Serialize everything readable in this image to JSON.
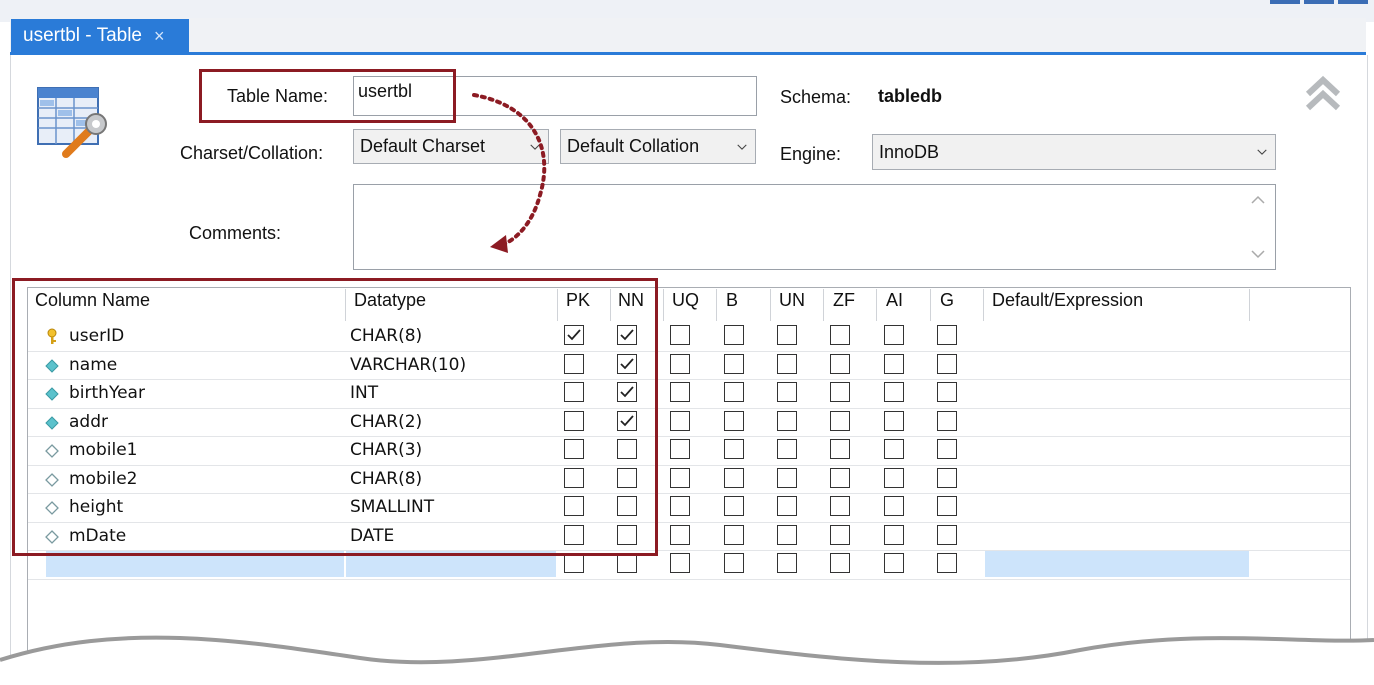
{
  "tab": {
    "title": "usertbl - Table",
    "close": "×"
  },
  "form": {
    "table_name_label": "Table Name:",
    "table_name_value": "usertbl",
    "schema_label": "Schema:",
    "schema_value": "tabledb",
    "charset_label": "Charset/Collation:",
    "charset_value": "Default Charset",
    "collation_value": "Default Collation",
    "engine_label": "Engine:",
    "engine_value": "InnoDB",
    "comments_label": "Comments:",
    "comments_value": ""
  },
  "grid": {
    "headers": [
      "Column Name",
      "Datatype",
      "PK",
      "NN",
      "UQ",
      "B",
      "UN",
      "ZF",
      "AI",
      "G",
      "Default/Expression"
    ],
    "rows": [
      {
        "icon": "primary-key-icon",
        "name": "userID",
        "type": "CHAR(8)",
        "flags": [
          true,
          true,
          false,
          false,
          false,
          false,
          false,
          false
        ]
      },
      {
        "icon": "filled-diamond-icon",
        "name": "name",
        "type": "VARCHAR(10)",
        "flags": [
          false,
          true,
          false,
          false,
          false,
          false,
          false,
          false
        ]
      },
      {
        "icon": "filled-diamond-icon",
        "name": "birthYear",
        "type": "INT",
        "flags": [
          false,
          true,
          false,
          false,
          false,
          false,
          false,
          false
        ]
      },
      {
        "icon": "filled-diamond-icon",
        "name": "addr",
        "type": "CHAR(2)",
        "flags": [
          false,
          true,
          false,
          false,
          false,
          false,
          false,
          false
        ]
      },
      {
        "icon": "hollow-diamond-icon",
        "name": "mobile1",
        "type": "CHAR(3)",
        "flags": [
          false,
          false,
          false,
          false,
          false,
          false,
          false,
          false
        ]
      },
      {
        "icon": "hollow-diamond-icon",
        "name": "mobile2",
        "type": "CHAR(8)",
        "flags": [
          false,
          false,
          false,
          false,
          false,
          false,
          false,
          false
        ]
      },
      {
        "icon": "hollow-diamond-icon",
        "name": "height",
        "type": "SMALLINT",
        "flags": [
          false,
          false,
          false,
          false,
          false,
          false,
          false,
          false
        ]
      },
      {
        "icon": "hollow-diamond-icon",
        "name": "mDate",
        "type": "DATE",
        "flags": [
          false,
          false,
          false,
          false,
          false,
          false,
          false,
          false
        ]
      },
      {
        "icon": "",
        "name": "",
        "type": "",
        "flags": [
          false,
          false,
          false,
          false,
          false,
          false,
          false,
          false
        ]
      }
    ]
  },
  "colors": {
    "accent": "#2a7bd8",
    "highlight_box": "#8c1b23",
    "new_row": "#cde4fb"
  }
}
